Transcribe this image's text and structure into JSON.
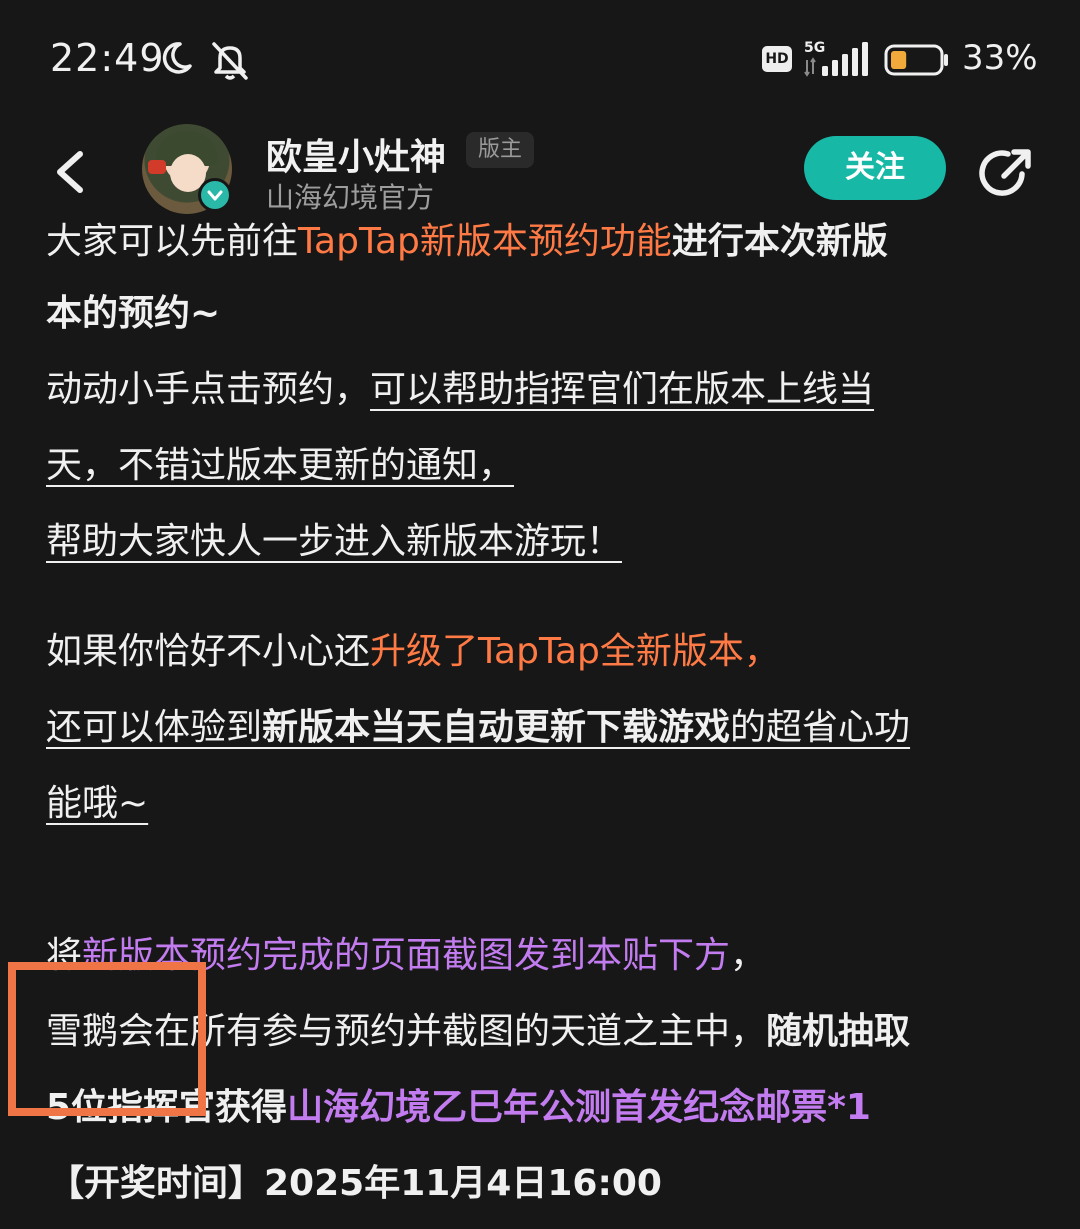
{
  "status_bar": {
    "time": "22:49",
    "hd_label": "HD",
    "network_label": "5G",
    "battery_percent": "33%",
    "battery_level": 0.33,
    "icons": [
      "moon-icon",
      "mute-icon",
      "hd-icon",
      "signal-icon",
      "battery-icon"
    ]
  },
  "header": {
    "author_name": "欧皇小灶神",
    "moderator_badge": "版主",
    "author_sub": "山海幻境官方",
    "follow_label": "关注",
    "accent_color": "#17b8a6"
  },
  "content": {
    "line1_a": "大家可以先前往",
    "line1_b": "TapTap新版本预约功能",
    "line1_c": "进行本次新版",
    "line2": "本的预约~",
    "line3_a": "动动小手点击预约，",
    "line3_b": "可以帮助指挥官们在版本上线当",
    "line4": "天，不错过版本更新的通知，",
    "line5": "帮助大家快人一步进入新版本游玩！",
    "line6_a": "如果你恰好不小心还",
    "line6_b": "升级了TapTap全新版本，",
    "line7_a": "还可以体验到",
    "line7_b": "新版本当天自动更新下载游戏",
    "line7_c": "的超省心功",
    "line8": "能哦~",
    "line9_a": "将",
    "line9_b": "新版本预约完成的页面截图发到本贴下方",
    "line9_c": "，",
    "line10_a": "雪鹅会在所有参与预约并截图的天道之主中，",
    "line10_b": "随机抽取",
    "line11_a": "5位指挥官获得",
    "line11_b": "山海幻境乙巳年公测首发纪念邮票*1",
    "line12": "【开奖时间】2025年11月4日16:00",
    "orange_color": "#ff7a45",
    "purple_color": "#c27cf0",
    "highlight_color": "#f07546"
  }
}
